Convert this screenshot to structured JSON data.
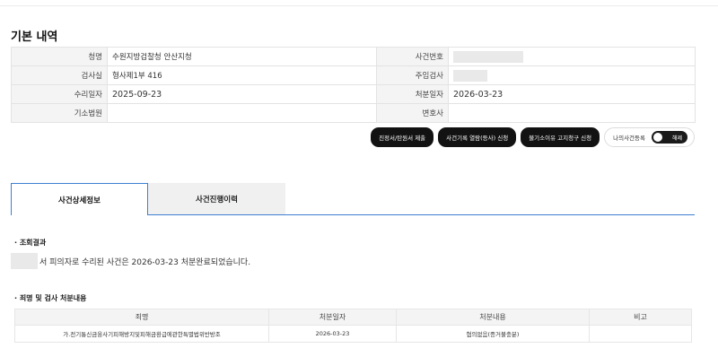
{
  "section_title": "기본 내역",
  "case_info": {
    "rows": [
      {
        "label1": "청명",
        "value1": "수원지방검찰청 안산지청",
        "label2": "사건번호",
        "value2": ""
      },
      {
        "label1": "검사실",
        "value1": "형사제1부 416",
        "label2": "주임검사",
        "value2": ""
      },
      {
        "label1": "수리일자",
        "value1": "2025-09-23",
        "label2": "처분일자",
        "value2": "2026-03-23"
      },
      {
        "label1": "기소법원",
        "value1": "",
        "label2": "변호사",
        "value2": ""
      }
    ]
  },
  "actions": {
    "statement_label": "진정서/탄원서 제출",
    "record_view_label": "사건기록 열람(등사) 신청",
    "non_prosecution_label": "불기소이유 고지청구 신청",
    "my_case_label": "나의사건등록",
    "toggle_label": "해제"
  },
  "tabs": [
    {
      "label": "사건상세정보",
      "active": true
    },
    {
      "label": "사건진행이력",
      "active": false
    }
  ],
  "result": {
    "title": "· 조회결과",
    "text": "서 피의자로 수리된 사건은 2026-03-23 처분완료되었습니다."
  },
  "charges": {
    "title": "· 죄명 및 검사 처분내용",
    "headers": [
      "죄명",
      "처분일자",
      "처분내용",
      "비고"
    ],
    "rows": [
      [
        "가.전기통신금융사기피해방지및피해금환급에관한특별법위반방조",
        "2026-03-23",
        "혐의없음(증거불충분)",
        ""
      ]
    ]
  }
}
